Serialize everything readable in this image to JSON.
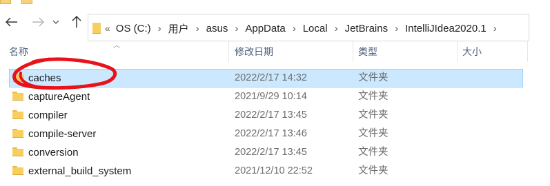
{
  "window": {
    "colors": {
      "selection_bg": "#cce8ff",
      "selection_border": "#99d1ff",
      "folder": "#f7cf5f",
      "annotation": "#e8131a"
    }
  },
  "nav": {
    "back_icon": "arrow-left-icon",
    "forward_icon": "arrow-right-icon",
    "recent_icon": "chevron-down-icon",
    "up_icon": "arrow-up-icon",
    "breadcrumbs": [
      "OS (C:)",
      "用户",
      "asus",
      "AppData",
      "Local",
      "JetBrains",
      "IntelliJIdea2020.1"
    ],
    "overflow": "«"
  },
  "columns": {
    "name": "名称",
    "modified": "修改日期",
    "type": "类型",
    "size": "大小"
  },
  "files": [
    {
      "name": "caches",
      "modified": "2022/2/17 14:32",
      "type": "文件夹",
      "selected": true
    },
    {
      "name": "captureAgent",
      "modified": "2021/9/29 10:14",
      "type": "文件夹"
    },
    {
      "name": "compiler",
      "modified": "2022/2/17 13:45",
      "type": "文件夹"
    },
    {
      "name": "compile-server",
      "modified": "2022/2/17 13:46",
      "type": "文件夹"
    },
    {
      "name": "conversion",
      "modified": "2022/2/17 13:45",
      "type": "文件夹"
    },
    {
      "name": "external_build_system",
      "modified": "2021/12/10 22:52",
      "type": "文件夹"
    }
  ]
}
